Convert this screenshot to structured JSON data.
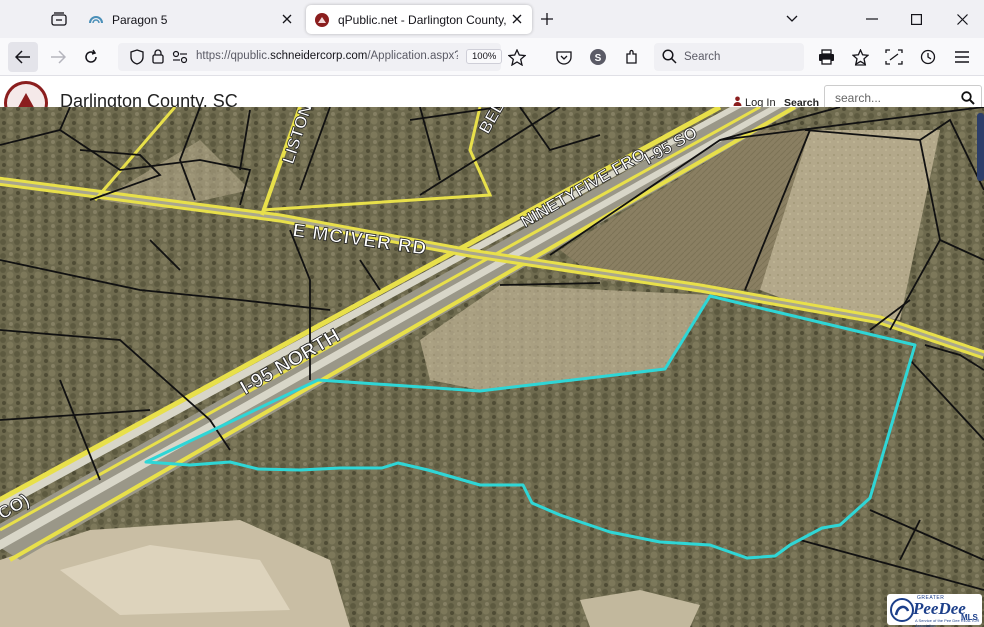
{
  "browser": {
    "tabs": [
      {
        "title": "Paragon 5",
        "active": false,
        "icon": "paragon-icon"
      },
      {
        "title": "qPublic.net - Darlington County, SC - Map",
        "active": true,
        "icon": "qpublic-icon"
      }
    ],
    "url": {
      "prefix": "https://qpublic.",
      "domain": "schneidercorp.com",
      "path": "/Application.aspx?AppID"
    },
    "zoom": "100%",
    "search_placeholder": "Search"
  },
  "site": {
    "title": "Darlington County, SC",
    "login_label": "Log In",
    "search_label": "Search",
    "search_placeholder": "search..."
  },
  "map": {
    "road_labels": {
      "mciver": "E MCIVER RD",
      "i95_north": "I-95 NORTH",
      "frontage": "NINETYFIVE FRO",
      "i95_south": "I-95 SO",
      "liston": "LISTON",
      "bel": "BEL",
      "florence": "FLORENCE CO)"
    },
    "parcel_highlight_color": "#2fd6d6",
    "road_color": "#e8e04a"
  },
  "badge": {
    "top": "GREATER",
    "name": "PeeDee",
    "suffix": "MLS",
    "tagline": "A Service of the Pee Dee REALTOR Association"
  },
  "colors": {
    "accent": "#8b1e1e",
    "brand_blue": "#1c3f8a"
  }
}
